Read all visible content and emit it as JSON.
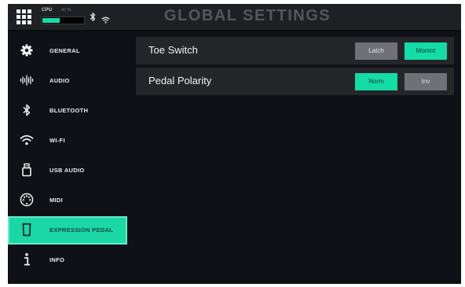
{
  "header": {
    "title": "GLOBAL SETTINGS",
    "menu_icon": "grid-menu-icon",
    "cpu": {
      "label": "CPU",
      "value_text": "42 %",
      "level": 0.42,
      "color": "#16dca8"
    },
    "status_icons": [
      "bluetooth-status-icon",
      "wifi-status-icon"
    ]
  },
  "sidebar": {
    "items": [
      {
        "label": "GENERAL",
        "icon": "gear-icon",
        "active": false
      },
      {
        "label": "AUDIO",
        "icon": "waveform-icon",
        "active": false
      },
      {
        "label": "BLUETOOTH",
        "icon": "bluetooth-icon",
        "active": false
      },
      {
        "label": "WI-FI",
        "icon": "wifi-icon",
        "active": false
      },
      {
        "label": "USB AUDIO",
        "icon": "usb-icon",
        "active": false
      },
      {
        "label": "MIDI",
        "icon": "midi-icon",
        "active": false
      },
      {
        "label": "EXPRESSION PEDAL",
        "icon": "expression-pedal-icon",
        "active": true
      },
      {
        "label": "INFO",
        "icon": "info-icon",
        "active": false
      }
    ]
  },
  "settings": [
    {
      "label": "Toe Switch",
      "options": [
        "Latch",
        "Momnt"
      ],
      "selected": "Momnt"
    },
    {
      "label": "Pedal Polarity",
      "options": [
        "Norm",
        "Inv"
      ],
      "selected": "Norm"
    }
  ],
  "colors": {
    "accent": "#15dca6",
    "background": "#101116",
    "row_background": "#25262a",
    "inactive_button": "#6f7176"
  }
}
